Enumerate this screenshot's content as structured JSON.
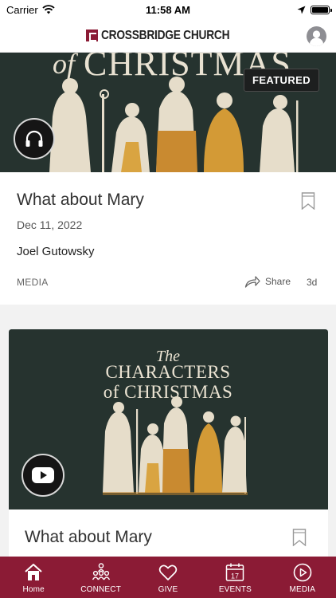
{
  "status_bar": {
    "carrier": "Carrier",
    "time": "11:58 AM"
  },
  "header": {
    "logo_text": "CROSSBRIDGE CHURCH",
    "avatar_icon": "user-avatar-icon"
  },
  "featured_post": {
    "badge": "FEATURED",
    "artwork_text": "of CHRISTMAS",
    "media_icon": "headphones-icon",
    "title": "What about Mary",
    "date": "Dec 11, 2022",
    "author": "Joel Gutowsky",
    "category": "MEDIA",
    "share_label": "Share",
    "age": "3d"
  },
  "second_post": {
    "artwork_line1": "The",
    "artwork_line2": "CHARACTERS",
    "artwork_line3": "of CHRISTMAS",
    "media_icon": "youtube-play-icon",
    "title": "What about Mary"
  },
  "tab_bar": {
    "accent_color": "#8b1b35",
    "tabs": [
      {
        "label": "Home",
        "icon": "home-icon"
      },
      {
        "label": "CONNECT",
        "icon": "connect-people-icon"
      },
      {
        "label": "GIVE",
        "icon": "heart-icon"
      },
      {
        "label": "EVENTS",
        "icon": "calendar-icon",
        "day": "17"
      },
      {
        "label": "MEDIA",
        "icon": "play-circle-icon"
      }
    ]
  }
}
